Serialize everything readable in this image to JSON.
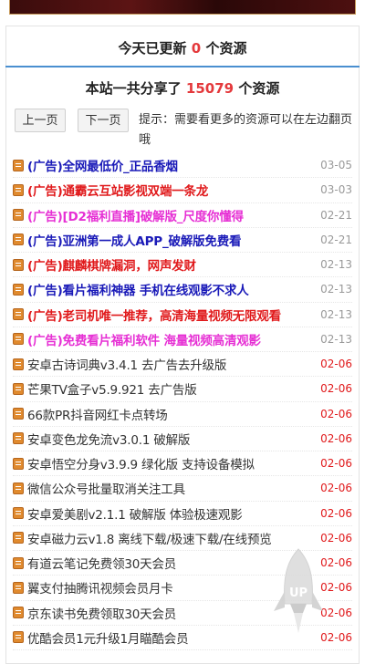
{
  "header": {
    "today_prefix": "今天已更新",
    "today_count": "0",
    "today_suffix": "个资源",
    "total_prefix": "本站一共分享了",
    "total_count": "15079",
    "total_suffix": "个资源"
  },
  "pager": {
    "prev_label": "上一页",
    "next_label": "下一页",
    "hint": "提示：需要看更多的资源可以在左边翻页哦"
  },
  "items": [
    {
      "title": "(广告)全网最低价_正品香烟",
      "date": "03-05",
      "title_color": "#1a1ab8",
      "date_color": "#999999",
      "ad": true
    },
    {
      "title": "(广告)通霸云互站影视双端一条龙",
      "date": "03-03",
      "title_color": "#e0191b",
      "date_color": "#999999",
      "ad": true
    },
    {
      "title": "(广告)[D2福利直播]破解版_尺度你懂得",
      "date": "02-21",
      "title_color": "#e62fd4",
      "date_color": "#999999",
      "ad": true
    },
    {
      "title": "(广告)亚洲第一成人APP_破解版免费看",
      "date": "02-21",
      "title_color": "#1a1ab8",
      "date_color": "#999999",
      "ad": true
    },
    {
      "title": "(广告)麒麟棋牌漏洞，网声发财",
      "date": "02-13",
      "title_color": "#e0191b",
      "date_color": "#999999",
      "ad": true
    },
    {
      "title": "(广告)看片福利神器 手机在线观影不求人",
      "date": "02-13",
      "title_color": "#1a1ab8",
      "date_color": "#999999",
      "ad": true
    },
    {
      "title": "(广告)老司机唯一推荐，高清海量视频无限观看",
      "date": "02-13",
      "title_color": "#e0191b",
      "date_color": "#999999",
      "ad": true
    },
    {
      "title": "(广告)免费看片福利软件 海量视频高清观影",
      "date": "02-13",
      "title_color": "#e62fd4",
      "date_color": "#999999",
      "ad": true
    },
    {
      "title": "安卓古诗词典v3.4.1 去广告去升级版",
      "date": "02-06",
      "title_color": "#333333",
      "date_color": "#e0191b",
      "ad": false
    },
    {
      "title": "芒果TV盒子v5.9.921 去广告版",
      "date": "02-06",
      "title_color": "#333333",
      "date_color": "#e0191b",
      "ad": false
    },
    {
      "title": "66款PR抖音网红卡点转场",
      "date": "02-06",
      "title_color": "#333333",
      "date_color": "#e0191b",
      "ad": false
    },
    {
      "title": "安卓变色龙免流v3.0.1 破解版",
      "date": "02-06",
      "title_color": "#333333",
      "date_color": "#e0191b",
      "ad": false
    },
    {
      "title": "安卓悟空分身v3.9.9 绿化版 支持设备模拟",
      "date": "02-06",
      "title_color": "#333333",
      "date_color": "#e0191b",
      "ad": false
    },
    {
      "title": "微信公众号批量取消关注工具",
      "date": "02-06",
      "title_color": "#333333",
      "date_color": "#e0191b",
      "ad": false
    },
    {
      "title": "安卓爱美剧v2.1.1 破解版 体验极速观影",
      "date": "02-06",
      "title_color": "#333333",
      "date_color": "#e0191b",
      "ad": false
    },
    {
      "title": "安卓磁力云v1.8 离线下载/极速下载/在线预览",
      "date": "02-06",
      "title_color": "#333333",
      "date_color": "#e0191b",
      "ad": false
    },
    {
      "title": "有道云笔记免费领30天会员",
      "date": "02-06",
      "title_color": "#333333",
      "date_color": "#e0191b",
      "ad": false
    },
    {
      "title": "翼支付抽腾讯视频会员月卡",
      "date": "02-06",
      "title_color": "#333333",
      "date_color": "#e0191b",
      "ad": false
    },
    {
      "title": "京东读书免费领取30天会员",
      "date": "02-06",
      "title_color": "#333333",
      "date_color": "#e0191b",
      "ad": false
    },
    {
      "title": "优酷会员1元升级1月瞄酷会员",
      "date": "02-06",
      "title_color": "#333333",
      "date_color": "#e0191b",
      "ad": false
    }
  ],
  "back_to_top": {
    "label": "UP"
  },
  "colors": {
    "accent_rule": "#4a8fd0",
    "count_red": "#e4393c"
  }
}
